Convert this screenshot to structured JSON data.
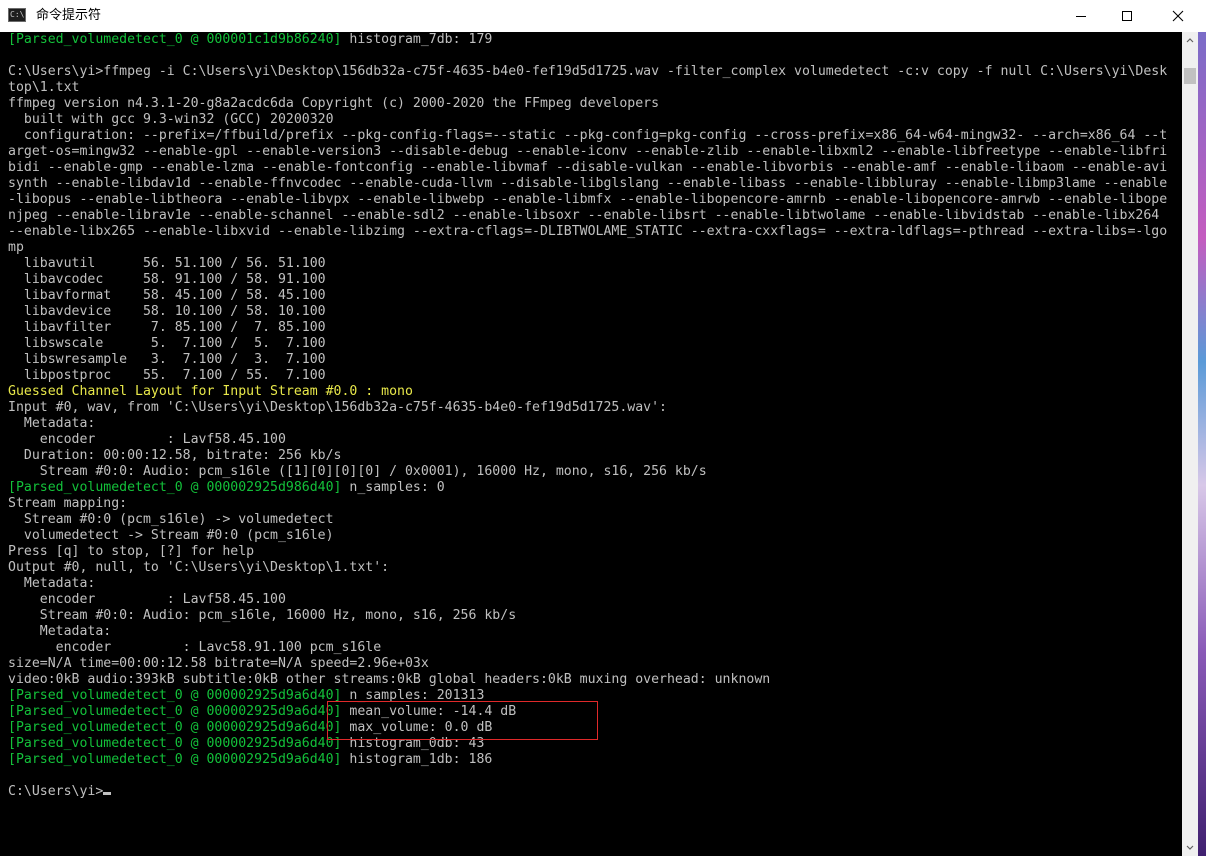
{
  "window": {
    "title": "命令提示符",
    "icon": "cmd-icon",
    "icon_text": "C:\\",
    "controls": [
      "minimize-icon",
      "maximize-icon",
      "close-icon"
    ]
  },
  "terminal": {
    "lines": [
      {
        "g": "[Parsed_volumedetect_0 @ 000001c1d9b86240]",
        "t": " histogram_7db: 179"
      },
      {
        "t": ""
      },
      {
        "t": "C:\\Users\\yi>ffmpeg -i C:\\Users\\yi\\Desktop\\156db32a-c75f-4635-b4e0-fef19d5d1725.wav -filter_complex volumedetect -c:v copy -f null C:\\Users\\yi\\Desk"
      },
      {
        "t": "top\\1.txt"
      },
      {
        "t": "ffmpeg version n4.3.1-20-g8a2acdc6da Copyright (c) 2000-2020 the FFmpeg developers"
      },
      {
        "t": "  built with gcc 9.3-win32 (GCC) 20200320"
      },
      {
        "t": "  configuration: --prefix=/ffbuild/prefix --pkg-config-flags=--static --pkg-config=pkg-config --cross-prefix=x86_64-w64-mingw32- --arch=x86_64 --t"
      },
      {
        "t": "arget-os=mingw32 --enable-gpl --enable-version3 --disable-debug --enable-iconv --enable-zlib --enable-libxml2 --enable-libfreetype --enable-libfri"
      },
      {
        "t": "bidi --enable-gmp --enable-lzma --enable-fontconfig --enable-libvmaf --disable-vulkan --enable-libvorbis --enable-amf --enable-libaom --enable-avi"
      },
      {
        "t": "synth --enable-libdav1d --enable-ffnvcodec --enable-cuda-llvm --disable-libglslang --enable-libass --enable-libbluray --enable-libmp3lame --enable"
      },
      {
        "t": "-libopus --enable-libtheora --enable-libvpx --enable-libwebp --enable-libmfx --enable-libopencore-amrnb --enable-libopencore-amrwb --enable-libope"
      },
      {
        "t": "njpeg --enable-librav1e --enable-schannel --enable-sdl2 --enable-libsoxr --enable-libsrt --enable-libtwolame --enable-libvidstab --enable-libx264"
      },
      {
        "t": "--enable-libx265 --enable-libxvid --enable-libzimg --extra-cflags=-DLIBTWOLAME_STATIC --extra-cxxflags= --extra-ldflags=-pthread --extra-libs=-lgo"
      },
      {
        "t": "mp"
      },
      {
        "t": "  libavutil      56. 51.100 / 56. 51.100"
      },
      {
        "t": "  libavcodec     58. 91.100 / 58. 91.100"
      },
      {
        "t": "  libavformat    58. 45.100 / 58. 45.100"
      },
      {
        "t": "  libavdevice    58. 10.100 / 58. 10.100"
      },
      {
        "t": "  libavfilter     7. 85.100 /  7. 85.100"
      },
      {
        "t": "  libswscale      5.  7.100 /  5.  7.100"
      },
      {
        "t": "  libswresample   3.  7.100 /  3.  7.100"
      },
      {
        "t": "  libpostproc    55.  7.100 / 55.  7.100"
      },
      {
        "y": "Guessed Channel Layout for Input Stream #0.0 : mono"
      },
      {
        "t": "Input #0, wav, from 'C:\\Users\\yi\\Desktop\\156db32a-c75f-4635-b4e0-fef19d5d1725.wav':"
      },
      {
        "t": "  Metadata:"
      },
      {
        "t": "    encoder         : Lavf58.45.100"
      },
      {
        "t": "  Duration: 00:00:12.58, bitrate: 256 kb/s"
      },
      {
        "t": "    Stream #0:0: Audio: pcm_s16le ([1][0][0][0] / 0x0001), 16000 Hz, mono, s16, 256 kb/s"
      },
      {
        "g": "[Parsed_volumedetect_0 @ 000002925d986d40]",
        "t": " n_samples: 0"
      },
      {
        "t": "Stream mapping:"
      },
      {
        "t": "  Stream #0:0 (pcm_s16le) -> volumedetect"
      },
      {
        "t": "  volumedetect -> Stream #0:0 (pcm_s16le)"
      },
      {
        "t": "Press [q] to stop, [?] for help"
      },
      {
        "t": "Output #0, null, to 'C:\\Users\\yi\\Desktop\\1.txt':"
      },
      {
        "t": "  Metadata:"
      },
      {
        "t": "    encoder         : Lavf58.45.100"
      },
      {
        "t": "    Stream #0:0: Audio: pcm_s16le, 16000 Hz, mono, s16, 256 kb/s"
      },
      {
        "t": "    Metadata:"
      },
      {
        "t": "      encoder         : Lavc58.91.100 pcm_s16le"
      },
      {
        "t": "size=N/A time=00:00:12.58 bitrate=N/A speed=2.96e+03x"
      },
      {
        "t": "video:0kB audio:393kB subtitle:0kB other streams:0kB global headers:0kB muxing overhead: unknown"
      },
      {
        "g": "[Parsed_volumedetect_0 @ 000002925d9a6d40]",
        "t": " n_samples: 201313"
      },
      {
        "g": "[Parsed_volumedetect_0 @ 000002925d9a6d40]",
        "t": " mean_volume: -14.4 dB"
      },
      {
        "g": "[Parsed_volumedetect_0 @ 000002925d9a6d40]",
        "t": " max_volume: 0.0 dB"
      },
      {
        "g": "[Parsed_volumedetect_0 @ 000002925d9a6d40]",
        "t": " histogram_0db: 43"
      },
      {
        "g": "[Parsed_volumedetect_0 @ 000002925d9a6d40]",
        "t": " histogram_1db: 186"
      },
      {
        "t": ""
      },
      {
        "t": "C:\\Users\\yi>",
        "cursor": true
      }
    ]
  },
  "colors": {
    "background": "#000000",
    "text": "#c0c0c0",
    "green_prefix": "#13c13a",
    "yellow_warning": "#e8e84a",
    "highlight_box": "#e0292a",
    "titlebar": "#ffffff"
  }
}
